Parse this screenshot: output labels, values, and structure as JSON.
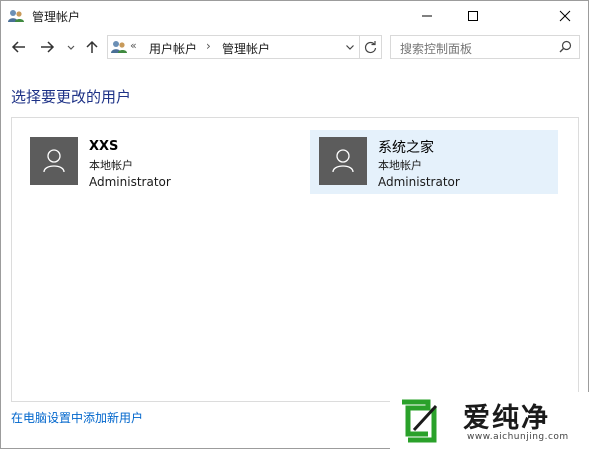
{
  "window": {
    "title": "管理帐户"
  },
  "address": {
    "overflow": "«",
    "crumbs": [
      "用户帐户",
      "管理帐户"
    ],
    "separator": "›"
  },
  "search": {
    "placeholder": "搜索控制面板"
  },
  "main": {
    "heading": "选择要更改的用户",
    "users": [
      {
        "name": "XXS",
        "type": "本地帐户",
        "role": "Administrator",
        "selected": false
      },
      {
        "name": "系统之家",
        "type": "本地帐户",
        "role": "Administrator",
        "selected": true
      }
    ],
    "add_user_link": "在电脑设置中添加新用户"
  },
  "watermark": {
    "text": "爱纯净",
    "url": "www.aichunjing.com"
  },
  "colors": {
    "heading": "#1e3287",
    "link": "#0066cc",
    "selected_tile": "#e5f1fb",
    "avatar": "#5c5c5c",
    "watermark_green": "#2aa12a"
  },
  "icons": [
    "users-icon",
    "minimize-icon",
    "maximize-icon",
    "close-icon",
    "back-arrow-icon",
    "forward-arrow-icon",
    "recent-chevron-icon",
    "up-arrow-icon",
    "dropdown-chevron-icon",
    "refresh-icon",
    "search-icon",
    "user-avatar-icon"
  ]
}
